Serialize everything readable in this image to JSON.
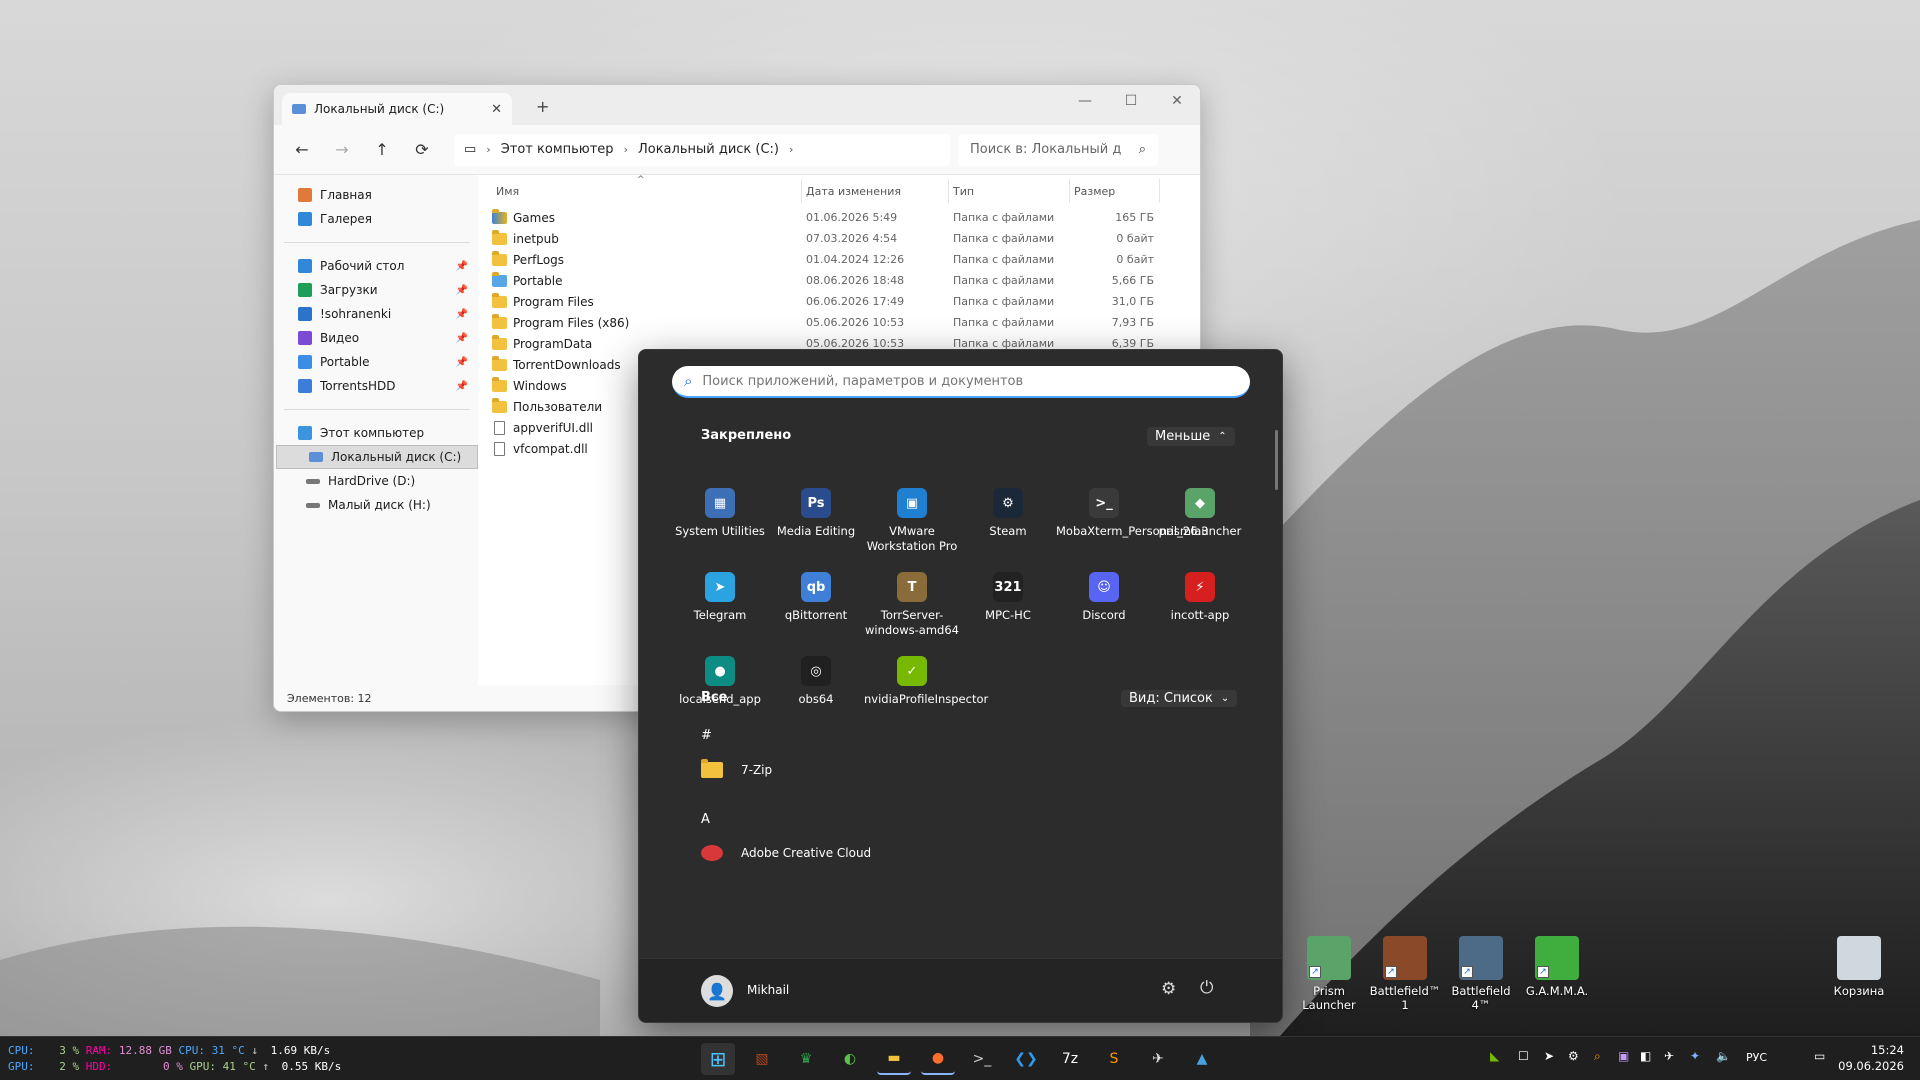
{
  "explorer": {
    "tab_title": "Локальный диск (C:)",
    "breadcrumb": [
      "Этот компьютер",
      "Локальный диск (C:)"
    ],
    "search_placeholder": "Поиск в: Локальный д",
    "nav": {
      "home": "Главная",
      "gallery": "Галерея",
      "quick": [
        {
          "label": "Рабочий стол",
          "icon": "desktop-icon",
          "color": "#2f89d8"
        },
        {
          "label": "Загрузки",
          "icon": "download-icon",
          "color": "#1e9e59"
        },
        {
          "label": "!sohranenki",
          "icon": "pictures-icon",
          "color": "#2c74c9"
        },
        {
          "label": "Видео",
          "icon": "video-icon",
          "color": "#7b4bd3"
        },
        {
          "label": "Portable",
          "icon": "folder-icon",
          "color": "#3a8ee6"
        },
        {
          "label": "TorrentsHDD",
          "icon": "qbittorrent-icon",
          "color": "#3b7dd8"
        }
      ],
      "this_pc": "Этот компьютер",
      "drives": [
        {
          "label": "Локальный диск (C:)",
          "selected": true
        },
        {
          "label": "HardDrive (D:)",
          "selected": false
        },
        {
          "label": "Малый диск (H:)",
          "selected": false
        }
      ]
    },
    "columns": {
      "name": "Имя",
      "date": "Дата изменения",
      "type": "Тип",
      "size": "Размер"
    },
    "rows": [
      {
        "name": "Games",
        "date": "01.06.2026 5:49",
        "type": "Папка с файлами",
        "size": "165 ГБ",
        "kind": "games"
      },
      {
        "name": "inetpub",
        "date": "07.03.2026 4:54",
        "type": "Папка с файлами",
        "size": "0 байт",
        "kind": "folder"
      },
      {
        "name": "PerfLogs",
        "date": "01.04.2024 12:26",
        "type": "Папка с файлами",
        "size": "0 байт",
        "kind": "folder"
      },
      {
        "name": "Portable",
        "date": "08.06.2026 18:48",
        "type": "Папка с файлами",
        "size": "5,66 ГБ",
        "kind": "portable"
      },
      {
        "name": "Program Files",
        "date": "06.06.2026 17:49",
        "type": "Папка с файлами",
        "size": "31,0 ГБ",
        "kind": "folder"
      },
      {
        "name": "Program Files (x86)",
        "date": "05.06.2026 10:53",
        "type": "Папка с файлами",
        "size": "7,93 ГБ",
        "kind": "folder"
      },
      {
        "name": "ProgramData",
        "date": "05.06.2026 10:53",
        "type": "Папка с файлами",
        "size": "6,39 ГБ",
        "kind": "folder"
      },
      {
        "name": "TorrentDownloads",
        "date": "",
        "type": "",
        "size": "",
        "kind": "folder"
      },
      {
        "name": "Windows",
        "date": "",
        "type": "",
        "size": "",
        "kind": "folder"
      },
      {
        "name": "Пользователи",
        "date": "",
        "type": "",
        "size": "",
        "kind": "folder"
      },
      {
        "name": "appverifUI.dll",
        "date": "",
        "type": "",
        "size": "",
        "kind": "file"
      },
      {
        "name": "vfcompat.dll",
        "date": "",
        "type": "",
        "size": "",
        "kind": "file"
      }
    ],
    "status": "Элементов: 12"
  },
  "start": {
    "search_placeholder": "Поиск приложений, параметров и документов",
    "pinned_title": "Закреплено",
    "less_label": "Меньше",
    "pinned": [
      {
        "label": "System Utilities",
        "icon": "system-utilities-icon",
        "color": "#3d6fb6",
        "glyph": "▦"
      },
      {
        "label": "Media Editing",
        "icon": "media-editing-icon",
        "color": "#2a4c8c",
        "glyph": "Ps"
      },
      {
        "label": "VMware Workstation Pro",
        "icon": "vmware-icon",
        "color": "#1f7fd0",
        "glyph": "▣"
      },
      {
        "label": "Steam",
        "icon": "steam-icon",
        "color": "#1b2838",
        "glyph": "⚙"
      },
      {
        "label": "MobaXterm_Personal_26.3",
        "icon": "mobaxterm-icon",
        "color": "#3a3a3a",
        "glyph": ">_"
      },
      {
        "label": "prismlauncher",
        "icon": "prism-icon",
        "color": "#5aa469",
        "glyph": "◆"
      },
      {
        "label": "Telegram",
        "icon": "telegram-icon",
        "color": "#2aa3e0",
        "glyph": "➤"
      },
      {
        "label": "qBittorrent",
        "icon": "qbittorrent-icon",
        "color": "#3f7fd8",
        "glyph": "qb"
      },
      {
        "label": "TorrServer-windows-amd64",
        "icon": "torrserver-icon",
        "color": "#8a6b3a",
        "glyph": "T"
      },
      {
        "label": "MPC-HC",
        "icon": "mpc-hc-icon",
        "color": "#222222",
        "glyph": "321"
      },
      {
        "label": "Discord",
        "icon": "discord-icon",
        "color": "#5865f2",
        "glyph": "☺"
      },
      {
        "label": "incott-app",
        "icon": "incott-icon",
        "color": "#d62020",
        "glyph": "⚡"
      },
      {
        "label": "localsend_app",
        "icon": "localsend-icon",
        "color": "#0d8c83",
        "glyph": "●"
      },
      {
        "label": "obs64",
        "icon": "obs-icon",
        "color": "#202020",
        "glyph": "◎"
      },
      {
        "label": "nvidiaProfileInspector",
        "icon": "nvidia-icon",
        "color": "#76b900",
        "glyph": "✓"
      }
    ],
    "all_title": "Все",
    "view_label": "Вид: Список",
    "list": [
      {
        "type": "letter",
        "text": "#"
      },
      {
        "type": "app",
        "text": "7-Zip",
        "icon": "folder-icon"
      },
      {
        "type": "letter",
        "text": "A"
      },
      {
        "type": "app",
        "text": "Adobe Creative Cloud",
        "icon": "adobe-cc-icon"
      }
    ],
    "user": "Mikhail"
  },
  "desktop_icons": [
    {
      "label": "Prism Launcher",
      "icon": "prism-launcher-icon",
      "color": "#5aa469"
    },
    {
      "label": "Battlefield™ 1",
      "icon": "battlefield-1-icon",
      "color": "#8a4a2a"
    },
    {
      "label": "Battlefield 4™",
      "icon": "battlefield-4-icon",
      "color": "#4d6a86"
    },
    {
      "label": "G.A.M.M.A.",
      "icon": "gamma-icon",
      "color": "#3fae3f"
    },
    {
      "label": "Корзина",
      "icon": "recycle-bin-icon",
      "color": "#cfd8df"
    }
  ],
  "stats": {
    "cpu_label": "CPU:",
    "cpu_val": "3 %",
    "ram_label": "RAM:",
    "ram_val": "12.88 GB",
    "cpu_temp_label": "CPU:",
    "cpu_temp": "31 °C",
    "down_val": "1.69 KB/s",
    "gpu_label": "GPU:",
    "gpu_val": "2 %",
    "hdd_label": "HDD:",
    "hdd_val": "0 %",
    "gpu_temp_label": "GPU:",
    "gpu_temp": "41 °C",
    "up_val": "0.55 KB/s"
  },
  "taskbar_apps": [
    {
      "icon": "start-icon",
      "color": "#4cc2ff",
      "glyph": "⊞"
    },
    {
      "icon": "photos-icon",
      "color": "#b3441c",
      "glyph": "▧"
    },
    {
      "icon": "crown-icon",
      "color": "#2fa44f",
      "glyph": "♛"
    },
    {
      "icon": "edge-icon",
      "color": "#5bc24b",
      "glyph": "◐"
    },
    {
      "icon": "file-explorer-icon",
      "color": "#f2c23f",
      "glyph": "▬"
    },
    {
      "icon": "firefox-icon",
      "color": "#ff6f2b",
      "glyph": "●"
    },
    {
      "icon": "terminal-icon",
      "color": "#cccccc",
      "glyph": ">_"
    },
    {
      "icon": "vscode-icon",
      "color": "#2f9cf0",
      "glyph": "❮❯"
    },
    {
      "icon": "7zip-icon",
      "color": "#ffffff",
      "glyph": "7z"
    },
    {
      "icon": "sublime-icon",
      "color": "#ff9800",
      "glyph": "S"
    },
    {
      "icon": "eagle-icon",
      "color": "#e0e0e0",
      "glyph": "✈"
    },
    {
      "icon": "image-viewer-icon",
      "color": "#48a2e0",
      "glyph": "▲"
    }
  ],
  "tray": {
    "lang": "РУС",
    "time": "15:24",
    "date": "09.06.2026"
  }
}
